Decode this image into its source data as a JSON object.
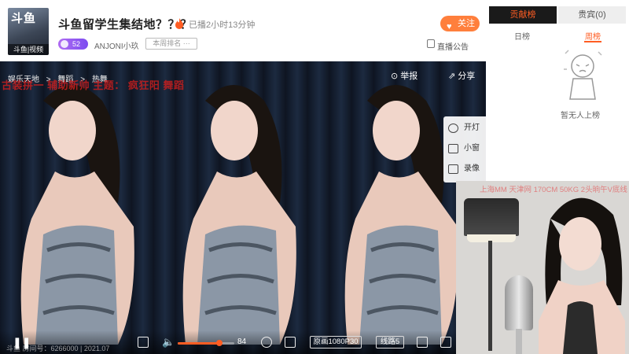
{
  "header": {
    "avatar_logo": "斗鱼",
    "avatar_caption": "斗鱼|视频",
    "title": "斗鱼留学生集结地？？？",
    "live_duration": "已播2小时13分钟",
    "level_badge": "52",
    "anchor_name": "ANJONI小玖",
    "rank_tag": "本周排名 ···",
    "follow_label": "关注",
    "notice_label": "直播公告"
  },
  "player": {
    "breadcrumb": [
      "娱乐天地",
      ">",
      "舞蹈",
      ">",
      "热舞"
    ],
    "overlay_text": "古装拼一 辅助新帅 主题： 疯狂阳 舞蹈",
    "report_label": "举报",
    "share_label": "分享",
    "side_menu": [
      {
        "label": "开灯",
        "icon": "lightbulb-icon"
      },
      {
        "label": "小窗",
        "icon": "mini-window-icon"
      },
      {
        "label": "录像",
        "icon": "record-icon"
      }
    ],
    "room_info": "斗鱼 房间号：6266000 | 2021.07",
    "volume_value": "84",
    "volume_level": 0.74,
    "quality_label": "原画1080P30",
    "line_label": "线路5"
  },
  "rank_panel": {
    "tabs": [
      "贡献榜",
      "贵宾(0)"
    ],
    "sub_tabs": [
      "日榜",
      "周榜"
    ],
    "empty_text": "暂无人上榜"
  },
  "camera": {
    "overlay_title": "上海MM 天津网 170CM 50KG 2头晌午V底线"
  },
  "colors": {
    "accent": "#ff5d23",
    "follow_button": "#ff7f3c",
    "level_badge": "#9a5cf2"
  }
}
